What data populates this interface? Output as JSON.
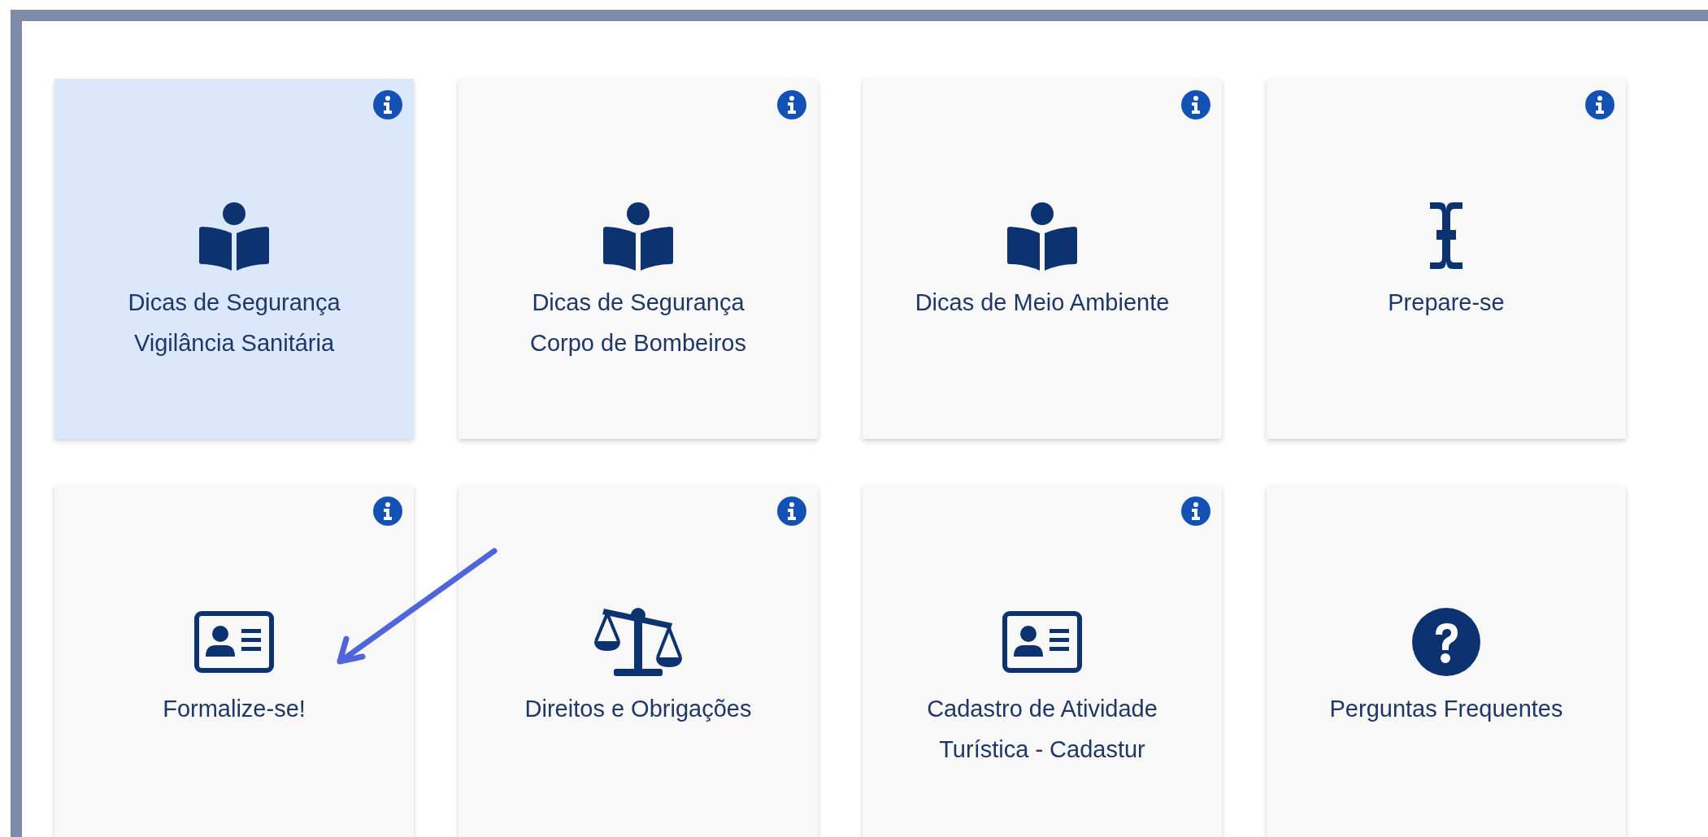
{
  "cards": [
    {
      "kind": "reader",
      "lines": [
        "Dicas de Segurança",
        "Vigilância Sanitária"
      ],
      "selected": true,
      "info": true
    },
    {
      "kind": "reader",
      "lines": [
        "Dicas de Segurança",
        "Corpo de Bombeiros"
      ],
      "selected": false,
      "info": true
    },
    {
      "kind": "reader",
      "lines": [
        "Dicas de Meio Ambiente"
      ],
      "selected": false,
      "info": true
    },
    {
      "kind": "cursor",
      "lines": [
        "Prepare-se"
      ],
      "selected": false,
      "info": true
    },
    {
      "kind": "idcard",
      "lines": [
        "Formalize-se!"
      ],
      "selected": false,
      "info": true
    },
    {
      "kind": "scale",
      "lines": [
        "Direitos e Obrigações"
      ],
      "selected": false,
      "info": true
    },
    {
      "kind": "idcard",
      "lines": [
        "Cadastro de Atividade",
        "Turística - Cadastur"
      ],
      "selected": false,
      "info": true
    },
    {
      "kind": "question",
      "lines": [
        "Perguntas Frequentes"
      ],
      "selected": false,
      "info": false
    }
  ]
}
